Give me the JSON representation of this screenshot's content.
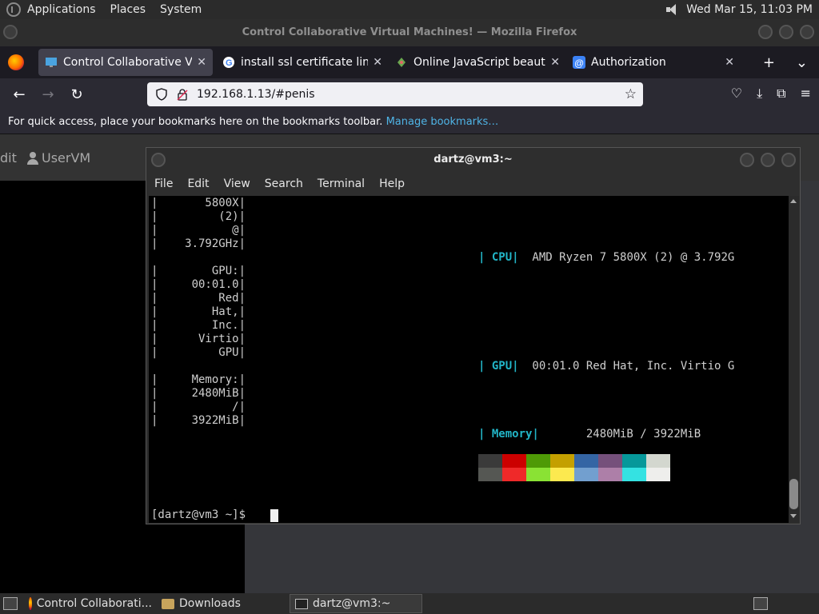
{
  "panel": {
    "menus": [
      "Applications",
      "Places",
      "System"
    ],
    "clock": "Wed Mar 15, 11:03 PM"
  },
  "firefox": {
    "window_title": "Control Collaborative Virtual Machines! — Mozilla Firefox",
    "tabs": [
      {
        "label": "Control Collaborative Virtual",
        "icon": "monitor-icon",
        "active": true
      },
      {
        "label": "install ssl certificate linux - G",
        "icon": "google-icon",
        "active": false
      },
      {
        "label": "Online JavaScript beautifier",
        "icon": "beautifier-icon",
        "active": false
      },
      {
        "label": "Authorization",
        "icon": "at-icon",
        "active": false
      }
    ],
    "url": "192.168.1.13/#penis",
    "bookmarks_text": "For quick access, place your bookmarks here on the bookmarks toolbar.",
    "bookmarks_link": "Manage bookmarks…"
  },
  "page": {
    "edit_label": "dit",
    "user_label": "UserVM"
  },
  "terminal": {
    "title": "dartz@vm3:~",
    "menus": [
      "File",
      "Edit",
      "View",
      "Search",
      "Terminal",
      "Help"
    ],
    "left_lines": [
      "|       5800X|",
      "|         (2)|",
      "|           @|",
      "|    3.792GHz|",
      "",
      "|        GPU:|",
      "|     00:01.0|",
      "|         Red|",
      "|        Hat,|",
      "|        Inc.|",
      "|      Virtio|",
      "|         GPU|",
      "",
      "|     Memory:|",
      "|     2480MiB|",
      "|           /|",
      "|     3922MiB|"
    ],
    "cpu_label": "| CPU|",
    "cpu_value": "  AMD Ryzen 7 5800X (2) @ 3.792G",
    "gpu_label": "| GPU|",
    "gpu_value": "  00:01.0 Red Hat, Inc. Virtio G",
    "mem_label": "| Memory|",
    "mem_value": "       2480MiB / 3922MiB",
    "prompt": "[dartz@vm3 ~]$ ",
    "palette_top": [
      "#3a3a3a",
      "#cc0000",
      "#4e9a06",
      "#c4a000",
      "#3465a4",
      "#75507b",
      "#06989a",
      "#d3d7cf"
    ],
    "palette_bottom": [
      "#555753",
      "#ef2929",
      "#8ae234",
      "#fce94f",
      "#729fcf",
      "#ad7fa8",
      "#34e2e2",
      "#eeeeec"
    ]
  },
  "taskbar": {
    "items": [
      {
        "label": "Control Collaborati...",
        "icon": "firefox-icon"
      },
      {
        "label": "Downloads",
        "icon": "folder-icon"
      },
      {
        "label": "dartz@vm3:~",
        "icon": "terminal-icon"
      }
    ]
  }
}
